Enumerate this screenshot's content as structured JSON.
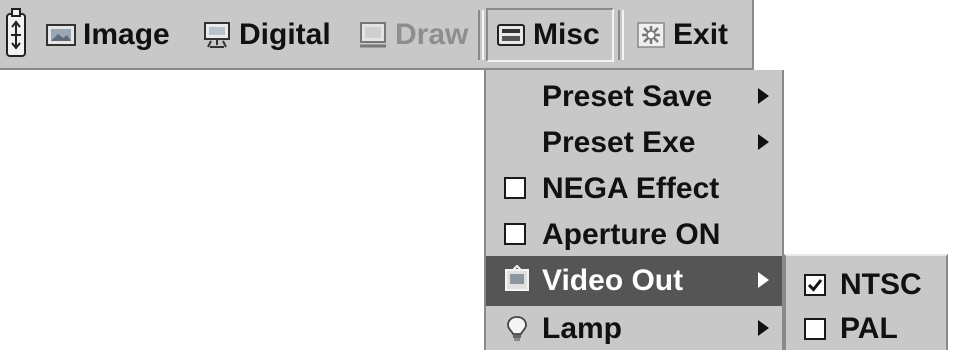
{
  "menubar": {
    "items": [
      {
        "label": "Image",
        "icon": "image-icon",
        "state": "normal"
      },
      {
        "label": "Digital",
        "icon": "digital-icon",
        "state": "normal"
      },
      {
        "label": "Draw",
        "icon": "draw-icon",
        "state": "disabled"
      },
      {
        "label": "Misc",
        "icon": "misc-icon",
        "state": "open"
      },
      {
        "label": "Exit",
        "icon": "exit-icon",
        "state": "normal"
      }
    ]
  },
  "misc_menu": {
    "items": [
      {
        "label": "Preset Save",
        "has_submenu": true
      },
      {
        "label": "Preset Exe",
        "has_submenu": true
      },
      {
        "label": "NEGA Effect",
        "type": "checkbox",
        "checked": false
      },
      {
        "label": "Aperture ON",
        "type": "checkbox",
        "checked": false
      },
      {
        "label": "Video Out",
        "icon": "video-out-icon",
        "has_submenu": true,
        "highlighted": true
      },
      {
        "label": "Lamp",
        "icon": "lamp-icon",
        "has_submenu": true
      }
    ]
  },
  "video_out_submenu": {
    "items": [
      {
        "label": "NTSC",
        "type": "checkbox",
        "checked": true
      },
      {
        "label": "PAL",
        "type": "checkbox",
        "checked": false
      }
    ]
  },
  "colors": {
    "menu_background": "#c8c8c8",
    "highlight_background": "#555555",
    "disabled_text": "#8e8e8e"
  }
}
